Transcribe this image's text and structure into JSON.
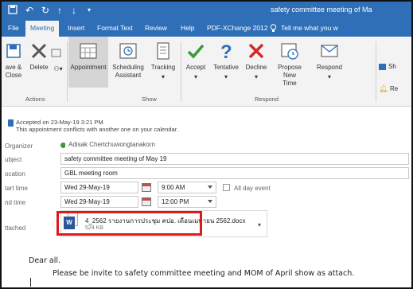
{
  "window": {
    "title": "safety committee meeting of Ma",
    "qat": [
      "save-icon",
      "undo-icon",
      "redo-icon",
      "up-icon",
      "down-icon",
      "customize-icon"
    ]
  },
  "tabs": [
    "File",
    "Meeting",
    "Insert",
    "Format Text",
    "Review",
    "Help",
    "PDF-XChange 2012",
    "Tell me what you w"
  ],
  "ribbon": {
    "actions": {
      "save_close": "ave &\nClose",
      "delete": "Delete",
      "group": "Actions"
    },
    "show": {
      "appointment": "Appointment",
      "scheduling": "Scheduling\nAssistant",
      "tracking": "Tracking",
      "group": "Show"
    },
    "respond": {
      "accept": "Accept",
      "tentative": "Tentative",
      "decline": "Decline",
      "propose": "Propose New\nTime",
      "respond": "Respond",
      "group": "Respond"
    },
    "extra": [
      "Sh",
      "Re"
    ]
  },
  "info": {
    "accepted": "Accepted on 23-May-19 3:21 PM.",
    "conflict": "This appointment conflicts with another one on your calendar."
  },
  "form": {
    "organizer_label": "Organizer",
    "organizer": "Adisak Chertchuwongtanakorn",
    "subject_label": "ubject",
    "subject": "safety committee meeting of May 19",
    "location_label": "ocation",
    "location": "GBL meeting room",
    "start_label": "tart time",
    "start_date": "Wed 29-May-19",
    "start_time": "9:00 AM",
    "allday": "All day event",
    "end_label": "nd time",
    "end_date": "Wed 29-May-19",
    "end_time": "12:00 PM",
    "attached_label": "ttached",
    "attachment_name": "4_2562 รายงานการประชุม คปอ. เดือนเมษายน 2562.docx",
    "attachment_size": "524 KB"
  },
  "body": {
    "greeting": "Dear all.",
    "message": "Please be invite to safety committee meeting and MOM of April show as attach."
  },
  "colors": {
    "accent": "#2f6fb7",
    "highlight": "#e01818",
    "accept": "#3c9a3c",
    "decline": "#d12b2b"
  }
}
